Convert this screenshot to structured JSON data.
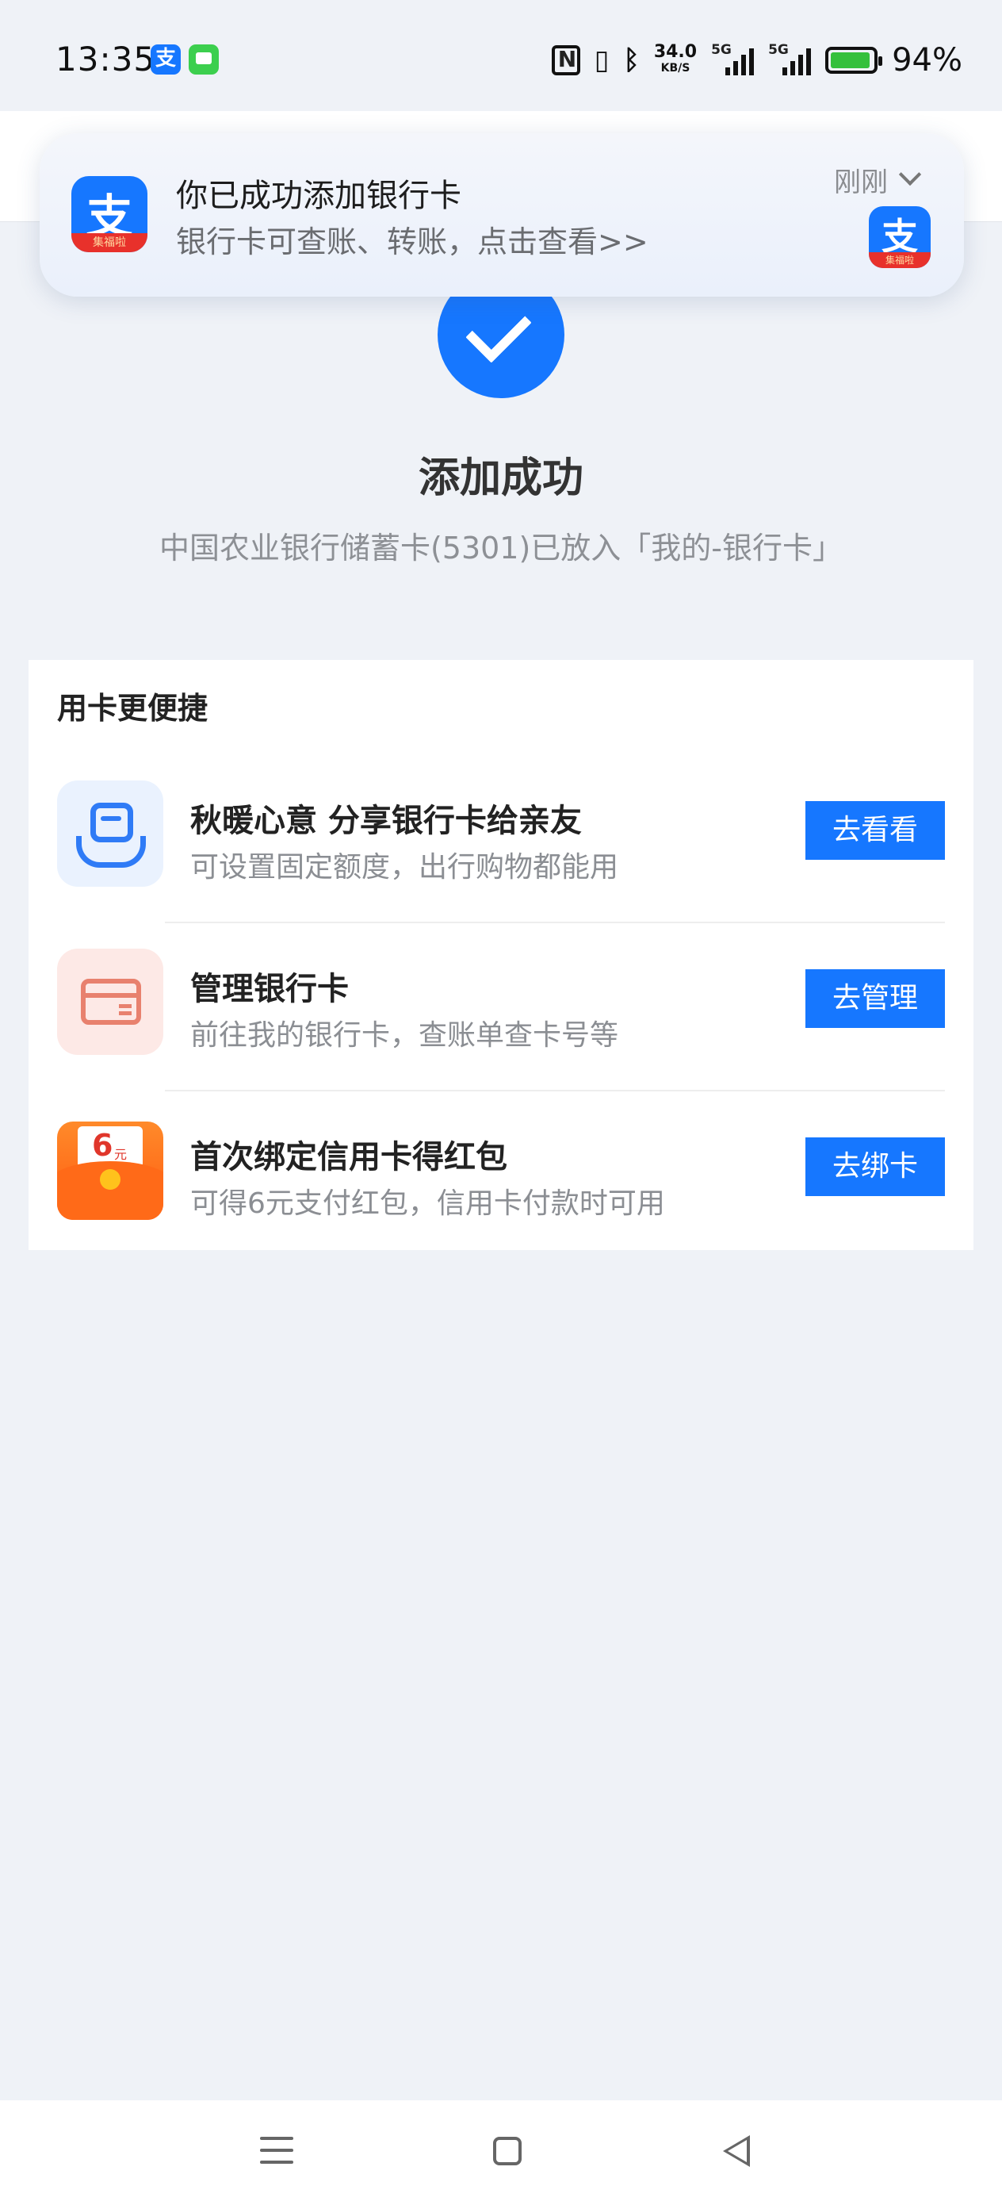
{
  "status_bar": {
    "time": "13:35",
    "net_speed_value": "34.0",
    "net_speed_unit": "KB/S",
    "signal_1_tag": "5G",
    "signal_2_tag": "5G",
    "battery_percent": "94%",
    "battery_level": 0.94,
    "icons": [
      "alipay-app-icon",
      "messages-app-icon",
      "nfc-icon",
      "vibrate-icon",
      "bluetooth-icon",
      "signal-icon",
      "battery-icon"
    ]
  },
  "notification": {
    "title": "你已成功添加银行卡",
    "body": "银行卡可查账、转账，点击查看>>",
    "time": "刚刚",
    "app_icon_glyph": "支",
    "app_icon_band": "集福啦"
  },
  "success": {
    "title": "添加成功",
    "subtitle": "中国农业银行储蓄卡(5301)已放入「我的-银行卡」"
  },
  "card_section": {
    "title": "用卡更便捷",
    "rows": [
      {
        "title": "秋暖心意 分享银行卡给亲友",
        "desc": "可设置固定额度，出行购物都能用",
        "button": "去看看",
        "icon": "hand-card-icon"
      },
      {
        "title": "管理银行卡",
        "desc": "前往我的银行卡，查账单查卡号等",
        "button": "去管理",
        "icon": "bank-card-icon"
      },
      {
        "title": "首次绑定信用卡得红包",
        "desc": "可得6元支付红包，信用卡付款时可用",
        "button": "去绑卡",
        "icon": "red-envelope-icon",
        "icon_amount": "6",
        "icon_unit": "元"
      }
    ]
  },
  "colors": {
    "accent": "#1677ff",
    "page_bg": "#eff2f7",
    "muted_text": "#8b8e93"
  }
}
